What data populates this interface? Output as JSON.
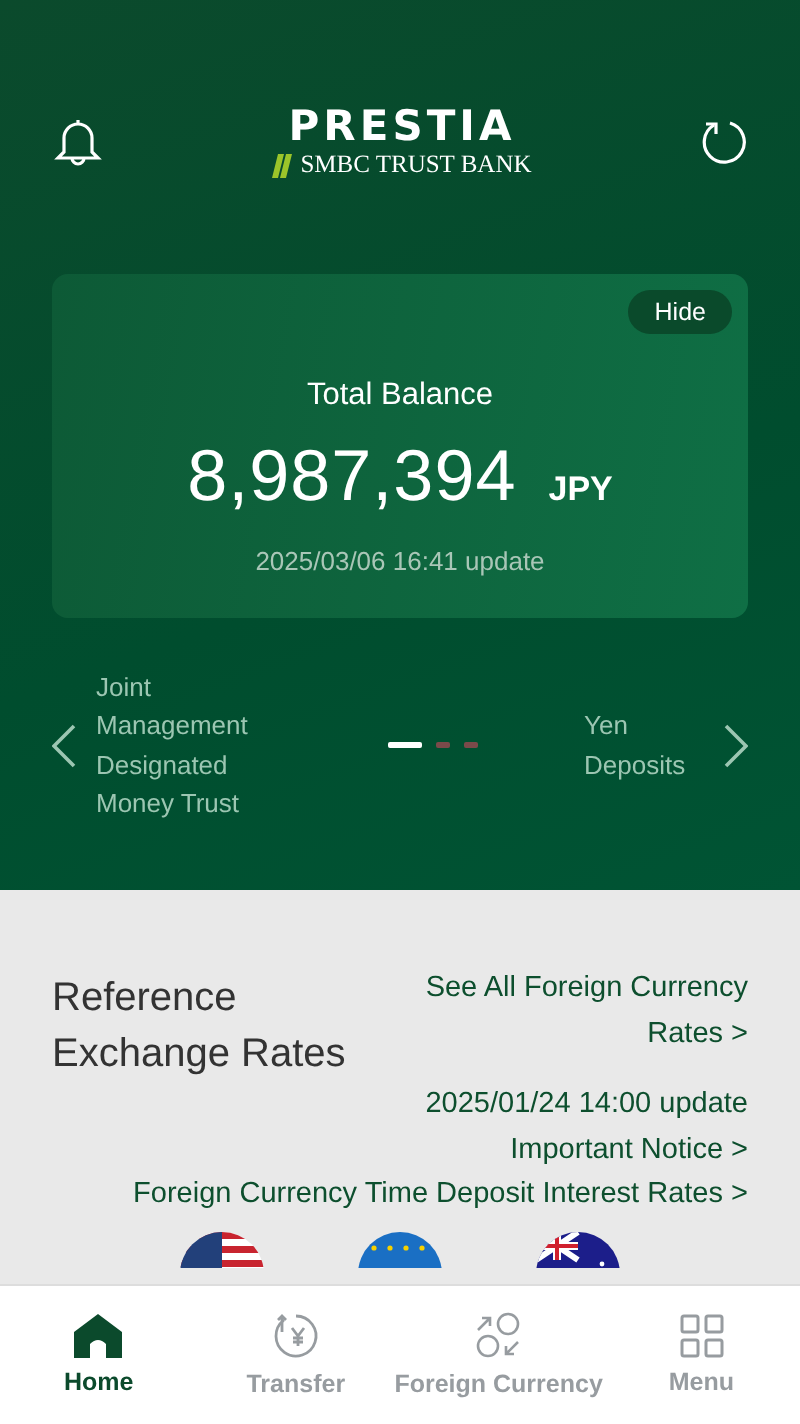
{
  "header": {
    "logo_title": "PRESTIA",
    "logo_subtitle": "SMBC TRUST BANK"
  },
  "balance_card": {
    "hide_button": "Hide",
    "label": "Total Balance",
    "amount": "8,987,394",
    "currency": "JPY",
    "updated": "2025/03/06 16:41 update"
  },
  "carousel": {
    "previous": "Joint Management Designated Money Trust",
    "next": "Yen Deposits",
    "dots": [
      {
        "selected": true
      },
      {
        "selected": false
      },
      {
        "selected": false
      }
    ]
  },
  "exchange": {
    "title": "Reference Exchange Rates",
    "see_all_link": "See All Foreign Currency Rates >",
    "updated": "2025/01/24 14:00 update",
    "notice_link": "Important Notice >",
    "interest_link": "Foreign Currency Time Deposit Interest Rates >",
    "flags": [
      {
        "kind": "usa"
      },
      {
        "kind": "eu"
      },
      {
        "kind": "australia"
      }
    ]
  },
  "bottom_nav": [
    {
      "kind": "home",
      "label": "Home",
      "selected": true
    },
    {
      "kind": "transfer",
      "label": "Transfer",
      "selected": false
    },
    {
      "kind": "fx",
      "label": "Foreign Currency",
      "selected": false
    },
    {
      "kind": "menu",
      "label": "Menu",
      "selected": false
    }
  ]
}
